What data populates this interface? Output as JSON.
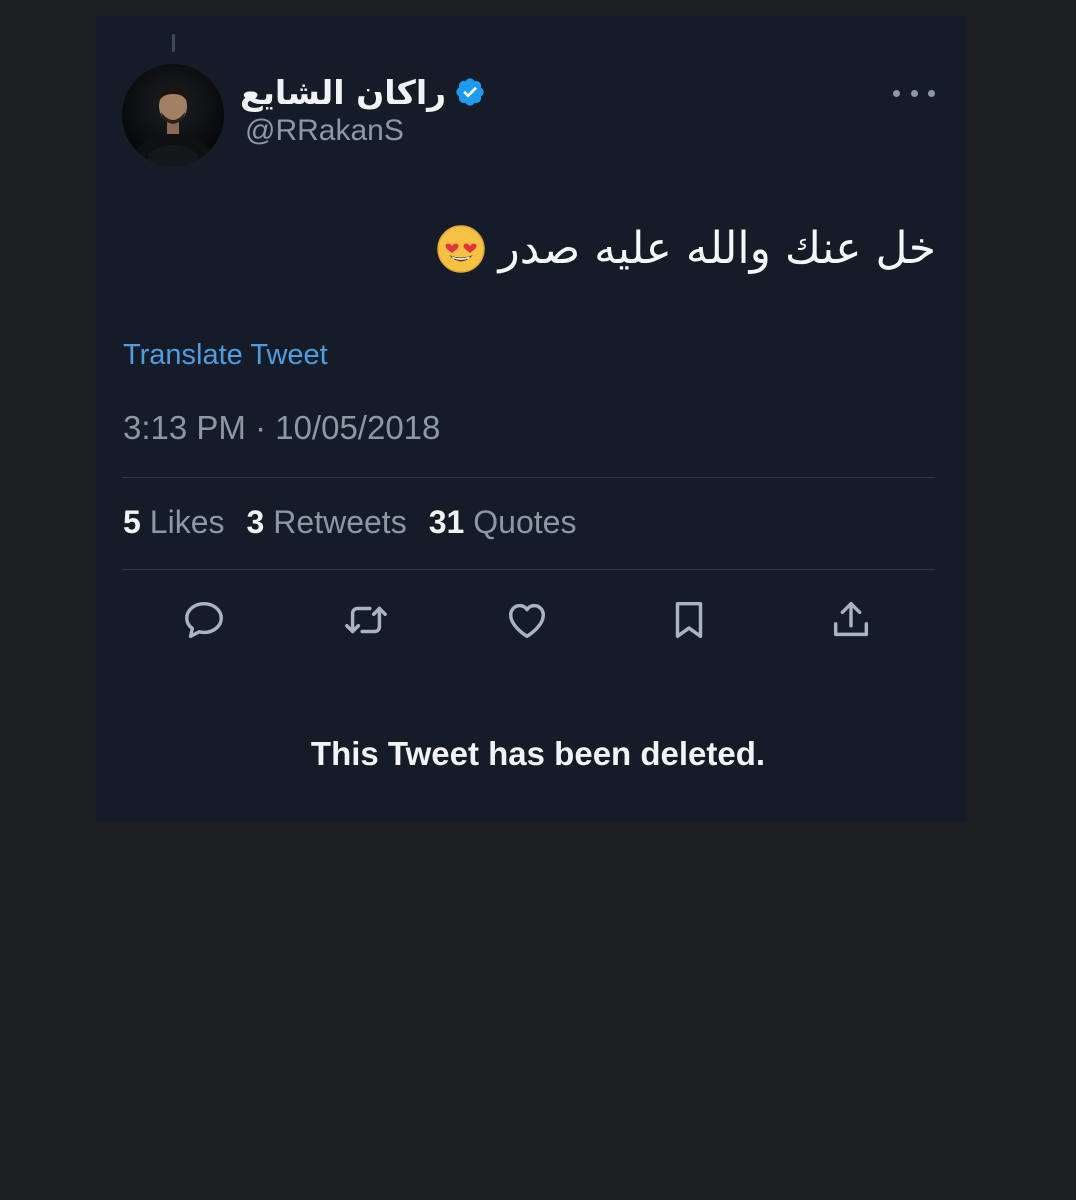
{
  "tweet": {
    "display_name": "راكان الشايع",
    "handle": "@RRakanS",
    "verified": true,
    "text": "خل عنك والله عليه صدر",
    "emoji": "heart-eyes-emoji",
    "translate_label": "Translate Tweet",
    "timestamp": "3:13 PM · 10/05/2018",
    "stats": [
      {
        "count": "5",
        "label": "Likes"
      },
      {
        "count": "3",
        "label": "Retweets"
      },
      {
        "count": "31",
        "label": "Quotes"
      }
    ],
    "actions": [
      "reply-icon",
      "retweet-icon",
      "like-icon",
      "bookmark-icon",
      "share-icon"
    ],
    "deleted_message": "This Tweet has been deleted."
  },
  "colors": {
    "page_background": "#1d1e20",
    "card_background": "#151c27",
    "link": "#4d9de0",
    "verified": "#1d9bf0",
    "secondary_text": "#8b98a5",
    "primary_text": "#f1f3f5"
  }
}
